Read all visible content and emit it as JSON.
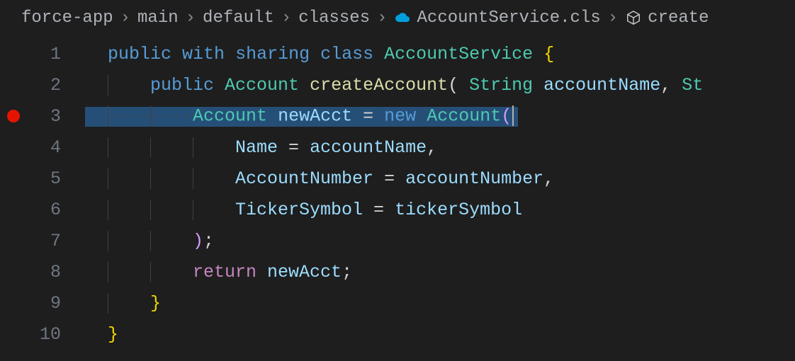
{
  "breadcrumb": {
    "items": [
      "force-app",
      "main",
      "default",
      "classes",
      "AccountService.cls",
      "create"
    ],
    "sep": "›"
  },
  "editor": {
    "highlightedLine": 3,
    "breakpointLine": 3,
    "lines": [
      {
        "num": "1",
        "indent": 0,
        "tokens": [
          {
            "t": "public",
            "c": "tok-kw"
          },
          {
            "t": " ",
            "c": "tok-plain"
          },
          {
            "t": "with",
            "c": "tok-kw"
          },
          {
            "t": " ",
            "c": "tok-plain"
          },
          {
            "t": "sharing",
            "c": "tok-kw"
          },
          {
            "t": " ",
            "c": "tok-plain"
          },
          {
            "t": "class",
            "c": "tok-kw"
          },
          {
            "t": " ",
            "c": "tok-plain"
          },
          {
            "t": "AccountService",
            "c": "tok-type"
          },
          {
            "t": " ",
            "c": "tok-plain"
          },
          {
            "t": "{",
            "c": "tok-brace"
          }
        ]
      },
      {
        "num": "2",
        "indent": 1,
        "tokens": [
          {
            "t": "public",
            "c": "tok-kw"
          },
          {
            "t": " ",
            "c": "tok-plain"
          },
          {
            "t": "Account",
            "c": "tok-type"
          },
          {
            "t": " ",
            "c": "tok-plain"
          },
          {
            "t": "createAccount",
            "c": "tok-func"
          },
          {
            "t": "( ",
            "c": "tok-punc"
          },
          {
            "t": "String",
            "c": "tok-type"
          },
          {
            "t": " ",
            "c": "tok-plain"
          },
          {
            "t": "accountName",
            "c": "tok-var"
          },
          {
            "t": ", ",
            "c": "tok-punc"
          },
          {
            "t": "St",
            "c": "tok-type"
          }
        ]
      },
      {
        "num": "3",
        "indent": 2,
        "tokens": [
          {
            "t": "Account",
            "c": "tok-type"
          },
          {
            "t": " ",
            "c": "tok-plain"
          },
          {
            "t": "newAcct",
            "c": "tok-var"
          },
          {
            "t": " ",
            "c": "tok-plain"
          },
          {
            "t": "=",
            "c": "tok-punc"
          },
          {
            "t": " ",
            "c": "tok-plain"
          },
          {
            "t": "new",
            "c": "tok-kw"
          },
          {
            "t": " ",
            "c": "tok-plain"
          },
          {
            "t": "Account",
            "c": "tok-type"
          },
          {
            "t": "(",
            "c": "tok-purple"
          }
        ],
        "cursor": true,
        "dots": true
      },
      {
        "num": "4",
        "indent": 3,
        "tokens": [
          {
            "t": "Name",
            "c": "tok-var"
          },
          {
            "t": " ",
            "c": "tok-plain"
          },
          {
            "t": "=",
            "c": "tok-punc"
          },
          {
            "t": " ",
            "c": "tok-plain"
          },
          {
            "t": "accountName",
            "c": "tok-var"
          },
          {
            "t": ",",
            "c": "tok-punc"
          }
        ]
      },
      {
        "num": "5",
        "indent": 3,
        "tokens": [
          {
            "t": "AccountNumber",
            "c": "tok-var"
          },
          {
            "t": " ",
            "c": "tok-plain"
          },
          {
            "t": "=",
            "c": "tok-punc"
          },
          {
            "t": " ",
            "c": "tok-plain"
          },
          {
            "t": "accountNumber",
            "c": "tok-var"
          },
          {
            "t": ",",
            "c": "tok-punc"
          }
        ]
      },
      {
        "num": "6",
        "indent": 3,
        "tokens": [
          {
            "t": "TickerSymbol",
            "c": "tok-var"
          },
          {
            "t": " ",
            "c": "tok-plain"
          },
          {
            "t": "=",
            "c": "tok-punc"
          },
          {
            "t": " ",
            "c": "tok-plain"
          },
          {
            "t": "tickerSymbol",
            "c": "tok-var"
          }
        ]
      },
      {
        "num": "7",
        "indent": 2,
        "tokens": [
          {
            "t": ")",
            "c": "tok-purple"
          },
          {
            "t": ";",
            "c": "tok-punc"
          }
        ]
      },
      {
        "num": "8",
        "indent": 2,
        "tokens": [
          {
            "t": "return",
            "c": "tok-mod"
          },
          {
            "t": " ",
            "c": "tok-plain"
          },
          {
            "t": "newAcct",
            "c": "tok-var"
          },
          {
            "t": ";",
            "c": "tok-punc"
          }
        ]
      },
      {
        "num": "9",
        "indent": 1,
        "tokens": [
          {
            "t": "}",
            "c": "tok-brace"
          }
        ]
      },
      {
        "num": "10",
        "indent": 0,
        "tokens": [
          {
            "t": "}",
            "c": "tok-brace"
          }
        ]
      }
    ]
  },
  "colors": {
    "background": "#1e1e1e",
    "highlight": "#264f78",
    "breakpoint": "#e51400"
  }
}
